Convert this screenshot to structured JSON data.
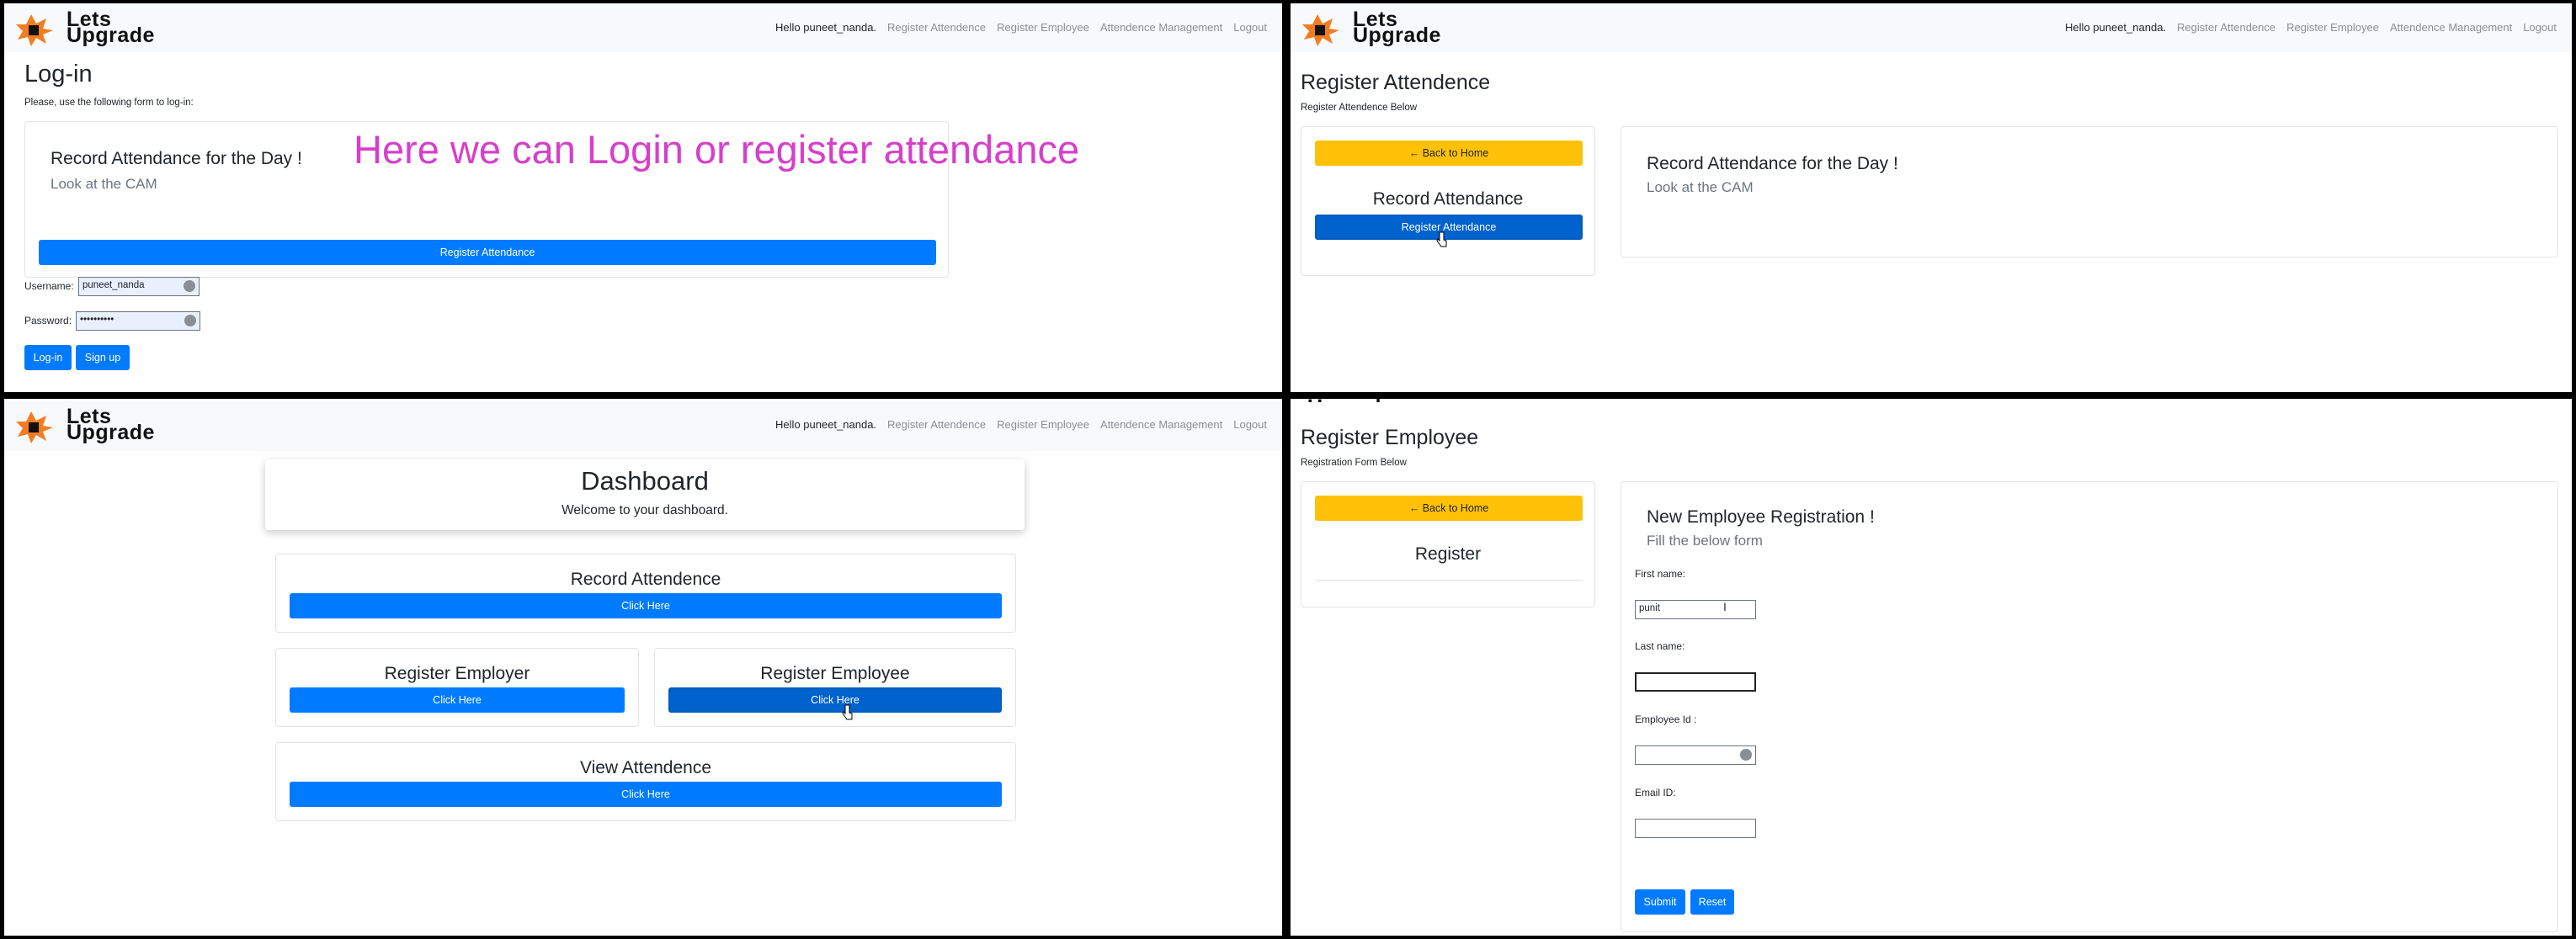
{
  "brand": {
    "logo_text": "Lets Upgrade"
  },
  "nav": {
    "hello": "Hello puneet_nanda.",
    "register_attendence": "Register Attendence",
    "register_employee": "Register Employee",
    "attendence_management": "Attendence Management",
    "logout": "Logout"
  },
  "login_panel": {
    "title": "Log-in",
    "subtitle": "Please, use the following form to log-in:",
    "card_title": "Record Attendance for the Day !",
    "card_sub": "Look at the CAM",
    "register_button": "Register Attendance",
    "username_label": "Username:",
    "username_value": "puneet_nanda",
    "password_label": "Password:",
    "password_value": "••••••••••",
    "login_button": "Log-in",
    "signup_button": "Sign up",
    "annotation": "Here we can Login or register attendance",
    "annotation_color": "#d63fcb"
  },
  "attendance_panel": {
    "title": "Register Attendence",
    "subtitle": "Register Attendence Below",
    "back_button": "← Back to Home",
    "side_title": "Record Attendance",
    "register_button": "Register Attendance",
    "card_title": "Record Attendance for the Day !",
    "card_sub": "Look at the CAM"
  },
  "dashboard_panel": {
    "title": "Dashboard",
    "welcome": "Welcome to your dashboard.",
    "cards": [
      {
        "title": "Record Attendence",
        "button": "Click Here"
      },
      {
        "title": "Register Employer",
        "button": "Click Here"
      },
      {
        "title": "Register Employee",
        "button": "Click Here"
      },
      {
        "title": "View Attendence",
        "button": "Click Here"
      }
    ]
  },
  "employee_panel": {
    "title": "Register Employee",
    "subtitle": "Registration Form Below",
    "back_button": "← Back to Home",
    "side_title": "Register",
    "form_title": "New Employee Registration !",
    "form_sub": "Fill the below form",
    "first_name_label": "First name:",
    "first_name_value": "punit",
    "last_name_label": "Last name:",
    "last_name_value": "",
    "employee_id_label": "Employee Id :",
    "employee_id_value": "",
    "email_label": "Email ID:",
    "email_value": "",
    "submit_button": "Submit",
    "reset_button": "Reset"
  },
  "colors": {
    "primary": "#007bff",
    "warning": "#ffc107",
    "navbar": "#f8f9fa",
    "logo_orange": "#f47c20"
  }
}
